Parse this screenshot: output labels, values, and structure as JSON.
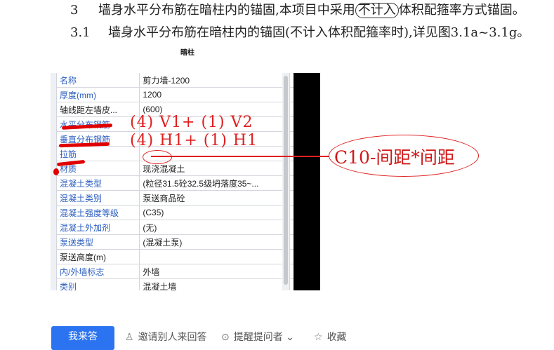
{
  "doc": {
    "heading": {
      "num": "3",
      "text_before": "墙身水平分布筋在暗柱内的锚固,本项目中采用",
      "circled": "不计入",
      "text_after": "体积配箍率方式锚固。"
    },
    "sub": {
      "num": "3.1",
      "text": "墙身水平分布筋在暗柱内的锚固(不计入体积配箍率时),详见图3.1a~3.1g。"
    },
    "caption": "暗柱"
  },
  "properties": [
    {
      "name": "名称",
      "value": "剪力墙-1200",
      "checkbox": false,
      "checked": false,
      "label_color": "blue"
    },
    {
      "name": "厚度(mm)",
      "value": "1200",
      "checkbox": true,
      "checked": false,
      "label_color": "blue"
    },
    {
      "name": "轴线距左墙皮...",
      "value": "(600)",
      "checkbox": true,
      "checked": false,
      "label_color": "plain"
    },
    {
      "name": "水平分布钢筋",
      "value": "",
      "checkbox": true,
      "checked": false,
      "label_color": "blue"
    },
    {
      "name": "垂直分布钢筋",
      "value": "",
      "checkbox": true,
      "checked": false,
      "label_color": "blue"
    },
    {
      "name": "拉筋",
      "value": "",
      "checkbox": true,
      "checked": false,
      "label_color": "blue"
    },
    {
      "name": "材质",
      "value": "现浇混凝土",
      "checkbox": true,
      "checked": false,
      "label_color": "blue"
    },
    {
      "name": "混凝土类型",
      "value": "(粒径31.5砼32.5级坍落度35~...",
      "checkbox": true,
      "checked": false,
      "label_color": "blue"
    },
    {
      "name": "混凝土类别",
      "value": "泵送商品砼",
      "checkbox": true,
      "checked": false,
      "label_color": "blue"
    },
    {
      "name": "混凝土强度等级",
      "value": "(C35)",
      "checkbox": true,
      "checked": false,
      "label_color": "blue"
    },
    {
      "name": "混凝土外加剂",
      "value": "(无)",
      "checkbox": false,
      "checked": false,
      "label_color": "blue"
    },
    {
      "name": "泵送类型",
      "value": "(混凝土泵)",
      "checkbox": false,
      "checked": false,
      "label_color": "blue"
    },
    {
      "name": "泵送高度(m)",
      "value": "",
      "checkbox": false,
      "checked": false,
      "label_color": "plain"
    },
    {
      "name": "内/外墙标志",
      "value": "外墙",
      "checkbox": true,
      "checked": true,
      "label_color": "blue"
    },
    {
      "name": "类别",
      "value": "混凝土墙",
      "checkbox": true,
      "checked": false,
      "label_color": "blue"
    }
  ],
  "annotations": {
    "horizontal_bar": "(4) V1+ (1) V2",
    "vertical_bar": "(4) H1+ (1) H1",
    "ellipse_note": "C10-间距*间距"
  },
  "actions": {
    "answer_button": "我来答",
    "invite": "邀请别人来回答",
    "remind": "提醒提问者",
    "collect": "收藏"
  },
  "colors": {
    "accent": "#2b73f0",
    "annotation_red": "#e02020",
    "label_blue": "#2c5ec0"
  }
}
